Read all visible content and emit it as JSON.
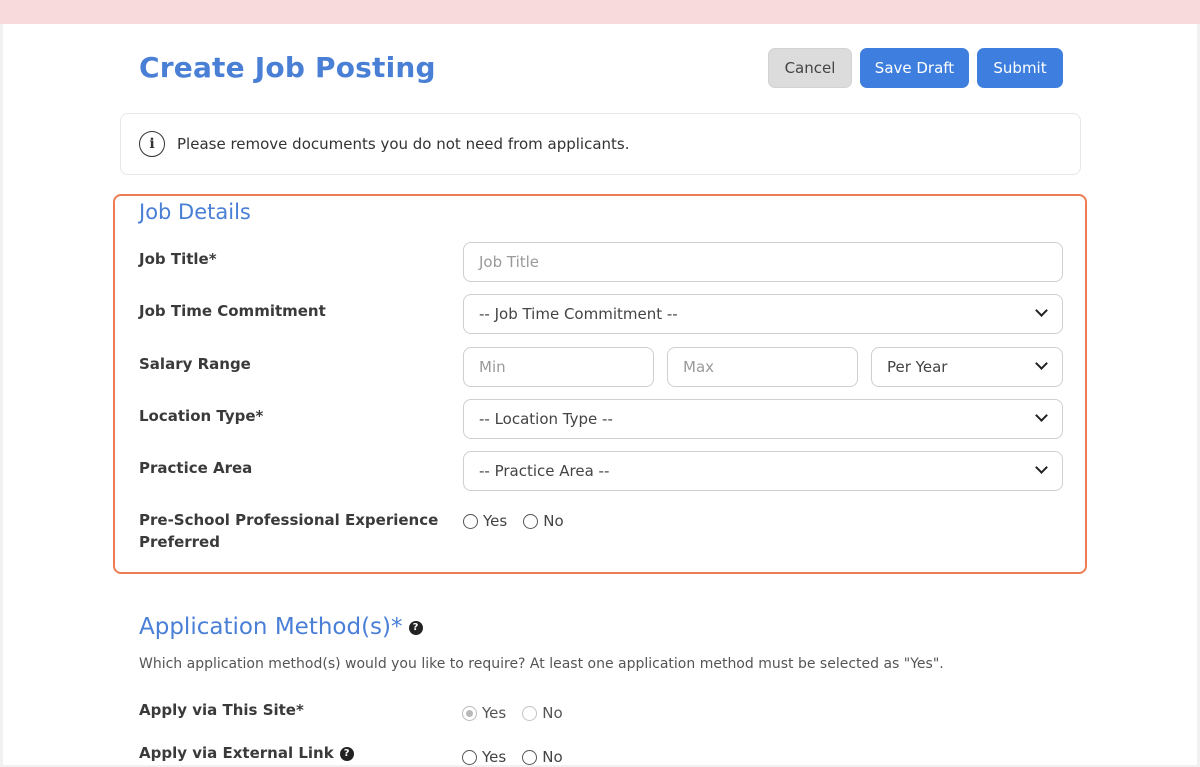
{
  "header": {
    "title": "Create Job Posting",
    "cancel_label": "Cancel",
    "save_draft_label": "Save Draft",
    "submit_label": "Submit"
  },
  "notice": {
    "icon": "info-icon",
    "text": "Please remove documents you do not need from applicants."
  },
  "job_details": {
    "title": "Job Details",
    "job_title": {
      "label": "Job Title*",
      "placeholder": "Job Title"
    },
    "time_commitment": {
      "label": "Job Time Commitment",
      "selected": "-- Job Time Commitment --"
    },
    "salary": {
      "label": "Salary Range",
      "min_placeholder": "Min",
      "max_placeholder": "Max",
      "period_selected": "Per Year"
    },
    "location_type": {
      "label": "Location Type*",
      "selected": "-- Location Type --"
    },
    "practice_area": {
      "label": "Practice Area",
      "selected": "-- Practice Area --"
    },
    "preschool_experience": {
      "label": "Pre-School Professional Experience Preferred",
      "options": [
        "Yes",
        "No"
      ]
    }
  },
  "application_methods": {
    "title": "Application Method(s)*",
    "help": "Which application method(s) would you like to require? At least one application method must be selected as \"Yes\".",
    "apply_site": {
      "label": "Apply via This Site*",
      "options": [
        "Yes",
        "No"
      ],
      "selected": "Yes"
    },
    "apply_external": {
      "label": "Apply via External Link",
      "options": [
        "Yes",
        "No"
      ]
    }
  },
  "colors": {
    "accent": "#4a7fd6",
    "primary_button": "#3d7ede",
    "highlight_border": "#ef7b52",
    "top_bar": "#f8d9dc"
  }
}
